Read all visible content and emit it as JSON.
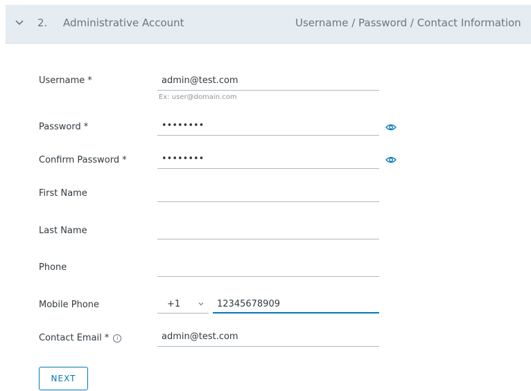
{
  "step": {
    "number": "2.",
    "title": "Administrative Account",
    "summary": "Username / Password / Contact Information",
    "icon": "chevron-down-icon"
  },
  "fields": {
    "username": {
      "label": "Username",
      "required": "*",
      "value": "admin@test.com",
      "helper": "Ex: user@domain.com"
    },
    "password": {
      "label": "Password",
      "required": "*",
      "value": "••••••••",
      "icon": "eye-icon"
    },
    "confirm_password": {
      "label": "Confirm Password",
      "required": "*",
      "value": "••••••••",
      "icon": "eye-icon"
    },
    "first_name": {
      "label": "First Name",
      "value": ""
    },
    "last_name": {
      "label": "Last Name",
      "value": ""
    },
    "phone": {
      "label": "Phone",
      "value": ""
    },
    "mobile_phone": {
      "label": "Mobile Phone",
      "country_code": "+1",
      "value": "12345678909"
    },
    "contact_email": {
      "label": "Contact Email",
      "required": "*",
      "info_icon": "info-icon",
      "value": "admin@test.com"
    }
  },
  "actions": {
    "next_label": "NEXT"
  },
  "colors": {
    "accent": "#0079b8",
    "header_bg": "#e6edf2"
  }
}
